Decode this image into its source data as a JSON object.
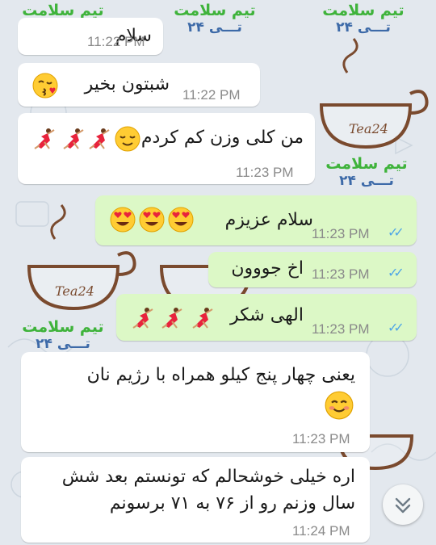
{
  "watermark": {
    "line1": "تیم سلامت",
    "line2": "تـــی ۲۴",
    "logo": "Tea24"
  },
  "messages": [
    {
      "dir": "in",
      "text": "سلام",
      "time": "11:22 PM"
    },
    {
      "dir": "in",
      "text": "شبتون بخیر",
      "emoji": [
        "face-blowing-kiss"
      ],
      "time": "11:22 PM"
    },
    {
      "dir": "in",
      "text": "من کلی وزن کم کردم",
      "emoji": [
        "relieved-face",
        "dancer",
        "dancer",
        "dancer"
      ],
      "time": "11:23 PM"
    },
    {
      "dir": "out",
      "text": "سلام عزیزم",
      "emoji": [
        "heart-eyes",
        "heart-eyes",
        "heart-eyes"
      ],
      "time": "11:23 PM",
      "status": "read"
    },
    {
      "dir": "out",
      "text": "اخ جووون",
      "time": "11:23 PM",
      "status": "read"
    },
    {
      "dir": "out",
      "text": "الهی شکر",
      "emoji": [
        "dancer",
        "dancer",
        "dancer"
      ],
      "time": "11:23 PM",
      "status": "read"
    },
    {
      "dir": "in",
      "text": "یعنی چهار پنج کیلو همراه با رژیم نان",
      "emoji": [
        "smiling-face"
      ],
      "time": "11:23 PM"
    },
    {
      "dir": "in",
      "text": "اره خیلی خوشحالم که تونستم بعد شش سال وزنم رو از ۷۶ به ۷۱ برسونم",
      "time": "11:24 PM"
    }
  ],
  "scroll_button": {
    "icon": "double-chevron-down-icon"
  }
}
